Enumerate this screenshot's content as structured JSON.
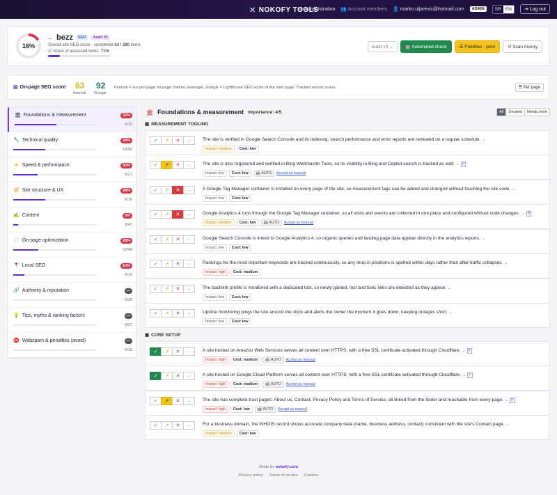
{
  "header": {
    "brand": "NOKOFY TOOLS",
    "administration": "Administration",
    "account_members": "Account members",
    "email": "marko.uljarevic@hotmail.com",
    "admin_badge": "ADMIN",
    "lang_sr": "SR",
    "lang_en": "EN",
    "logout": "Log out"
  },
  "score": {
    "percent_label": "16%",
    "percent": 16,
    "project": "bezz",
    "tag_seo": "SEO",
    "tag_audit": "Audit #1",
    "overall_prefix": "Overall site SEO score · completed",
    "completed": "54 / 280",
    "overall_suffix": "items",
    "assessed_prefix": "Score of assessed items:",
    "assessed": "71%",
    "progress": 0.19,
    "audit_select": "Audit #3",
    "btn_auto": "Automated check",
    "btn_print": "Priorities - print",
    "btn_history": "Scan history"
  },
  "onpage": {
    "label": "On-page SEO score",
    "internal_value": "63",
    "internal_label": "Internal",
    "google_value": "92",
    "google_label": "Google",
    "desc": "Internal = our per-page on-page checks (average); Google = Lighthouse SEO score of the start page. Tracked across scans.",
    "per_page": "Per page"
  },
  "sidebar": {
    "items": [
      {
        "label": "Foundations & measurement",
        "pct": "32%",
        "count": "6/12",
        "fill": 0.5,
        "color": "#d6394a"
      },
      {
        "label": "Technical quality",
        "pct": "24%",
        "count": "19/50",
        "fill": 0.38,
        "color": "#d6394a"
      },
      {
        "label": "Speed & performance",
        "pct": "30%",
        "count": "6/21",
        "fill": 0.29,
        "color": "#d6394a"
      },
      {
        "label": "Site structure & UX",
        "pct": "28%",
        "count": "6/16",
        "fill": 0.38,
        "color": "#d6394a"
      },
      {
        "label": "Content",
        "pct": "5%",
        "count": "3/47",
        "fill": 0.06,
        "color": "#d6394a"
      },
      {
        "label": "On-page optimization",
        "pct": "28%",
        "count": "12/40",
        "fill": 0.3,
        "color": "#d6394a"
      },
      {
        "label": "Local SEO",
        "pct": "10%",
        "count": "2/16",
        "fill": 0.13,
        "color": "#d6394a"
      },
      {
        "label": "Authority & reputation",
        "pct": "—",
        "count": "0/26",
        "fill": 0,
        "color": "#555"
      },
      {
        "label": "Tips, myths & ranking factors",
        "pct": "—",
        "count": "0/37",
        "fill": 0,
        "color": "#555"
      },
      {
        "label": "Webspam & penalties (avoid)",
        "pct": "—",
        "count": "0/15",
        "fill": 0,
        "color": "#555"
      }
    ]
  },
  "main": {
    "title": "Foundations & measurement",
    "importance": "Importance: 4/5",
    "filter": [
      "All",
      "Unrated",
      "Needs work"
    ],
    "section1": "MEASUREMENT TOOLING",
    "section2": "CORE SETUP",
    "impact_labels": {
      "medium": "Impact: medium",
      "low": "Impact: low",
      "high": "Impact: high"
    },
    "cost_labels": {
      "low": "Cost: low",
      "medium": "Cost: medium"
    },
    "auto_label": "AUTO",
    "manual_label": "Accept as manual",
    "checks": [
      {
        "text": "The site is verified in Google Search Console and its indexing, search performance and error reports are reviewed on a regular schedule.",
        "impact": "medium",
        "cost": "low",
        "auto": false,
        "state": "none"
      },
      {
        "text": "The site is also registered and verified in Bing Webmaster Tools, so its visibility in Bing and Copilot search is tracked as well.",
        "impact": "low",
        "cost": "low",
        "auto": true,
        "state": "part"
      },
      {
        "text": "A Google Tag Manager container is installed on every page of the site, so measurement tags can be added and changed without touching the site code.",
        "impact": "low",
        "cost": "low",
        "auto": false,
        "state": "no"
      },
      {
        "text": "Google Analytics 4 runs through the Google Tag Manager container, so all visits and events are collected in one place and configured without code changes.",
        "impact": "medium",
        "cost": "low",
        "auto": true,
        "state": "no"
      },
      {
        "text": "Google Search Console is linked to Google Analytics 4, so organic queries and landing page data appear directly in the analytics reports.",
        "impact": "low",
        "cost": "low",
        "auto": false,
        "state": "none"
      },
      {
        "text": "Rankings for the most important keywords are tracked continuously, so any drop in positions is spotted within days rather than after traffic collapses.",
        "impact": "high",
        "cost": "medium",
        "auto": false,
        "state": "none"
      },
      {
        "text": "The backlink profile is monitored with a dedicated tool, so newly gained, lost and toxic links are detected as they appear.",
        "impact": "low",
        "cost": "low",
        "auto": false,
        "state": "none"
      },
      {
        "text": "Uptime monitoring pings the site around the clock and alerts the owner the moment it goes down, keeping outages short.",
        "impact": "low",
        "cost": "low",
        "auto": false,
        "state": "none"
      },
      {
        "text": "A site hosted on Amazon Web Services serves all content over HTTPS, with a free SSL certificate activated through Cloudflare.",
        "impact": "high",
        "cost": "medium",
        "auto": true,
        "state": "ok"
      },
      {
        "text": "A site hosted on Google Cloud Platform serves all content over HTTPS, with a free SSL certificate activated through Cloudflare.",
        "impact": "high",
        "cost": "medium",
        "auto": true,
        "state": "ok"
      },
      {
        "text": "The site has complete trust pages: About us, Contact, Privacy Policy and Terms of Service, all linked from the footer and reachable from every page.",
        "impact": "high",
        "cost": "low",
        "auto": true,
        "state": "part"
      },
      {
        "text": "For a business domain, the WHOIS record shows accurate company data (name, business address, contact) consistent with the site's Contact page.",
        "impact": "medium",
        "cost": "low",
        "auto": false,
        "state": "none"
      }
    ]
  },
  "footer": {
    "made_by": "Made by",
    "made_by_link": "nokofy.com",
    "privacy": "Privacy policy",
    "terms": "Terms of service",
    "cookies": "Cookies",
    "sep": "·"
  }
}
